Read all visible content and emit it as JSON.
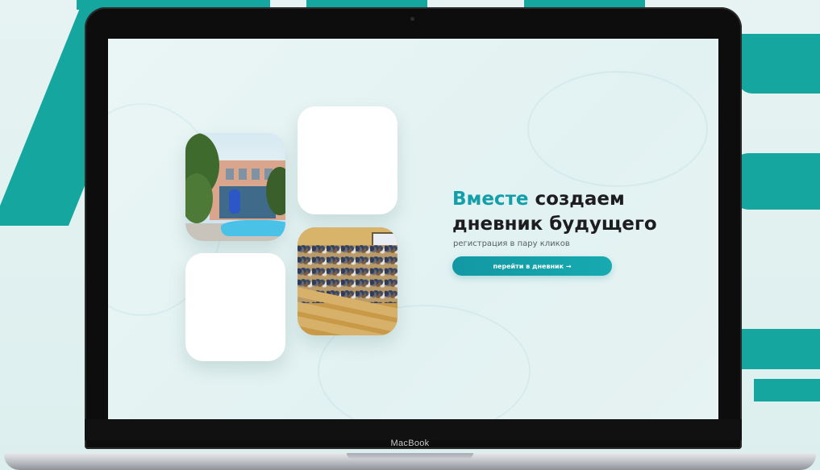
{
  "device": {
    "brand_label": "MacBook"
  },
  "hero": {
    "title_accent": "Вместе",
    "title_rest": " создаем",
    "title_line2": "дневник будущего",
    "subtitle": "регистрация в пару кликов",
    "cta_label": "перейти в дневник →"
  },
  "tiles": [
    {
      "content": "photo-building"
    },
    {
      "content": "blank"
    },
    {
      "content": "blank"
    },
    {
      "content": "photo-lecture-hall"
    }
  ],
  "colors": {
    "accent": "#129fa9",
    "background_letters": "#15a6a0",
    "button": "#1298a4",
    "title": "#1d1d1f"
  }
}
